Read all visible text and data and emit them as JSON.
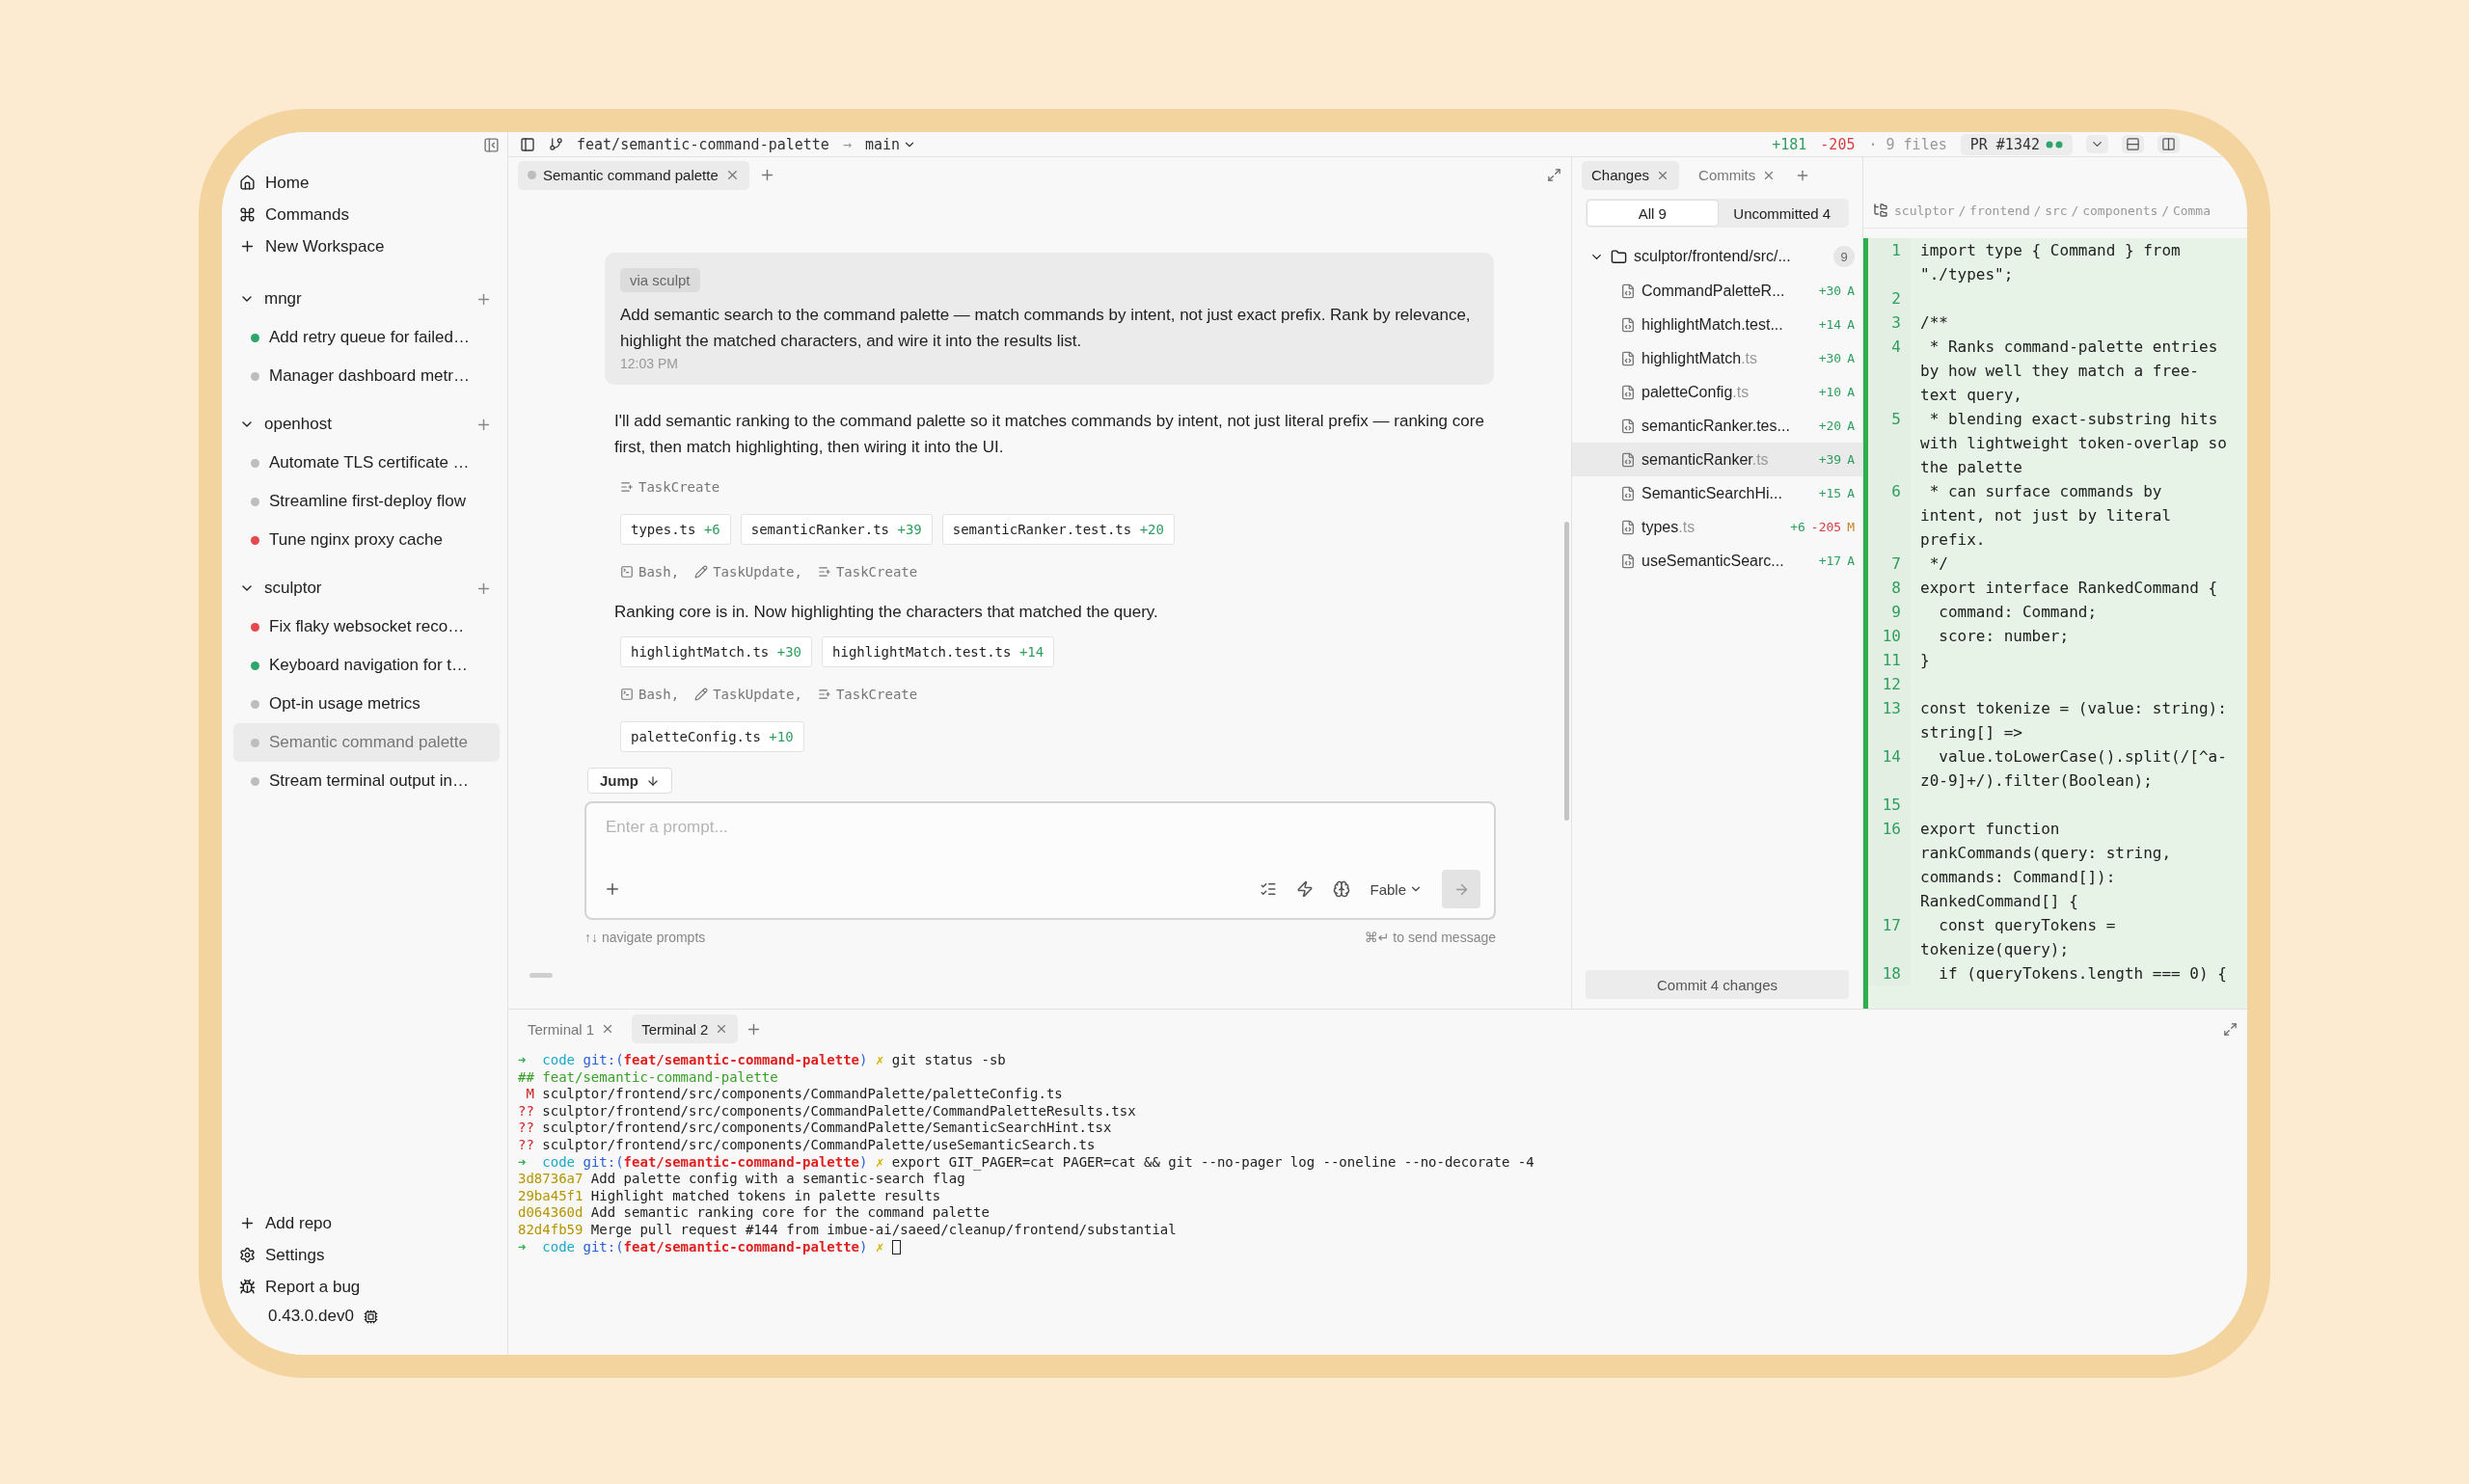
{
  "topbar": {
    "branch": "feat/semantic-command-palette",
    "arrow": "→",
    "base": "main",
    "added": "+181",
    "removed": "-205",
    "files": "· 9 files",
    "pr": "PR #1342"
  },
  "sidebar": {
    "nav": [
      {
        "kind": "home",
        "label": "Home"
      },
      {
        "kind": "command",
        "label": "Commands"
      },
      {
        "kind": "plus",
        "label": "New Workspace"
      }
    ],
    "repos": [
      {
        "name": "mngr",
        "expanded": true,
        "workspaces": [
          {
            "title": "Add retry queue for failed…",
            "color": "#2ea56a",
            "selected": false
          },
          {
            "title": "Manager dashboard metr…",
            "color": "#bdbdbd",
            "selected": false
          }
        ]
      },
      {
        "name": "openhost",
        "expanded": true,
        "workspaces": [
          {
            "title": "Automate TLS certificate …",
            "color": "#bdbdbd",
            "selected": false
          },
          {
            "title": "Streamline first-deploy flow",
            "color": "#bdbdbd",
            "selected": false
          },
          {
            "title": "Tune nginx proxy cache",
            "color": "#e5484d",
            "selected": false
          }
        ]
      },
      {
        "name": "sculptor",
        "expanded": true,
        "workspaces": [
          {
            "title": "Fix flaky websocket reco…",
            "color": "#e5484d",
            "selected": false
          },
          {
            "title": "Keyboard navigation for t…",
            "color": "#2ea56a",
            "selected": false
          },
          {
            "title": "Opt-in usage metrics",
            "color": "#bdbdbd",
            "selected": false
          },
          {
            "title": "Semantic command palette",
            "color": "#bdbdbd",
            "selected": true
          },
          {
            "title": "Stream terminal output in…",
            "color": "#bdbdbd",
            "selected": false
          }
        ]
      }
    ],
    "footer": [
      {
        "kind": "plus",
        "label": "Add repo"
      },
      {
        "kind": "settings",
        "label": "Settings"
      },
      {
        "kind": "bug",
        "label": "Report a bug"
      }
    ],
    "version": "0.43.0.dev0"
  },
  "chat": {
    "tabs": [
      {
        "label": "Semantic command palette",
        "selected": true
      }
    ],
    "items": [
      {
        "kind": "user",
        "tag": "via sculpt",
        "text": "Add semantic search to the command palette — match commands by intent, not just exact prefix. Rank by relevance, highlight the matched characters, and wire it into the results list.",
        "time": "12:03 PM"
      },
      {
        "kind": "text",
        "text": "I'll add semantic ranking to the command palette so it matches commands by intent, not just literal prefix — ranking core first, then match highlighting, then wiring it into the UI."
      },
      {
        "kind": "tools",
        "tools": [
          {
            "kind": "task",
            "label": "TaskCreate"
          }
        ]
      },
      {
        "kind": "files",
        "files": [
          {
            "name": "types.ts",
            "added": "+6"
          },
          {
            "name": "semanticRanker.ts",
            "added": "+39"
          },
          {
            "name": "semanticRanker.test.ts",
            "added": "+20"
          }
        ]
      },
      {
        "kind": "tools",
        "tools": [
          {
            "kind": "bash",
            "label": "Bash,"
          },
          {
            "kind": "edit",
            "label": "TaskUpdate,"
          },
          {
            "kind": "task",
            "label": "TaskCreate"
          }
        ]
      },
      {
        "kind": "text",
        "text": "Ranking core is in. Now highlighting the characters that matched the query."
      },
      {
        "kind": "files",
        "files": [
          {
            "name": "highlightMatch.ts",
            "added": "+30"
          },
          {
            "name": "highlightMatch.test.ts",
            "added": "+14"
          }
        ]
      },
      {
        "kind": "tools",
        "tools": [
          {
            "kind": "bash",
            "label": "Bash,"
          },
          {
            "kind": "edit",
            "label": "TaskUpdate,"
          },
          {
            "kind": "task",
            "label": "TaskCreate"
          }
        ]
      },
      {
        "kind": "files",
        "files": [
          {
            "name": "paletteConfig.ts",
            "added": "+10"
          }
        ]
      }
    ],
    "jump": "Jump",
    "composer": {
      "placeholder": "Enter a prompt...",
      "model": "Fable",
      "send_disabled": true
    },
    "hint_left": "↑↓ navigate prompts",
    "hint_right": "⌘↵ to send message"
  },
  "changes": {
    "tabs": [
      {
        "label": "Changes",
        "selected": true
      },
      {
        "label": "Commits",
        "selected": false
      }
    ],
    "filters": [
      {
        "label": "All 9",
        "selected": true
      },
      {
        "label": "Uncommitted 4",
        "selected": false
      }
    ],
    "folder": {
      "name": "sculptor/frontend/src/...",
      "count": "9",
      "expanded": true,
      "files": [
        {
          "name": "CommandPaletteR...",
          "added": "+30",
          "status": "A",
          "kind": "added",
          "selected": false
        },
        {
          "name": "highlightMatch.test...",
          "added": "+14",
          "status": "A",
          "kind": "added",
          "selected": false
        },
        {
          "name": "highlightMatch",
          "ext": ".ts",
          "added": "+30",
          "status": "A",
          "kind": "added",
          "selected": false
        },
        {
          "name": "paletteConfig",
          "ext": ".ts",
          "added": "+10",
          "status": "A",
          "kind": "added",
          "selected": false
        },
        {
          "name": "semanticRanker.tes...",
          "added": "+20",
          "status": "A",
          "kind": "added",
          "selected": false
        },
        {
          "name": "semanticRanker",
          "ext": ".ts",
          "added": "+39",
          "status": "A",
          "kind": "added",
          "selected": true
        },
        {
          "name": "SemanticSearchHi...",
          "added": "+15",
          "status": "A",
          "kind": "added",
          "selected": false
        },
        {
          "name": "types",
          "ext": ".ts",
          "added": "+6",
          "removed": "-205",
          "status": "M",
          "kind": "modified",
          "selected": false
        },
        {
          "name": "useSemanticSearc...",
          "added": "+17",
          "status": "A",
          "kind": "added",
          "selected": false
        }
      ]
    },
    "commit": "Commit 4 changes"
  },
  "code": {
    "path": "sculptor / frontend / src / components / Comma",
    "lines": [
      {
        "n": "1",
        "text": "import type { Command } from \"./types\";"
      },
      {
        "n": "2"
      },
      {
        "n": "3",
        "text": "/**"
      },
      {
        "n": "4",
        "text": " * Ranks command-palette entries by how well they match a free-text query,"
      },
      {
        "n": "5",
        "text": " * blending exact-substring hits with lightweight token-overlap so the palette"
      },
      {
        "n": "6",
        "text": " * can surface commands by intent, not just by literal prefix."
      },
      {
        "n": "7",
        "text": " */"
      },
      {
        "n": "8",
        "text": "export interface RankedCommand {"
      },
      {
        "n": "9",
        "text": "  command: Command;"
      },
      {
        "n": "10",
        "text": "  score: number;"
      },
      {
        "n": "11",
        "text": "}"
      },
      {
        "n": "12"
      },
      {
        "n": "13",
        "text": "const tokenize = (value: string): string[] =>"
      },
      {
        "n": "14",
        "text": "  value.toLowerCase().split(/[^a-z0-9]+/).filter(Boolean);"
      },
      {
        "n": "15"
      },
      {
        "n": "16",
        "text": "export function rankCommands(query: string, commands: Command[]): RankedCommand[] {"
      },
      {
        "n": "17",
        "text": "  const queryTokens = tokenize(query);"
      },
      {
        "n": "18",
        "text": "  if (queryTokens.length === 0) {"
      }
    ]
  },
  "terminal": {
    "tabs": [
      {
        "label": "Terminal 1",
        "selected": false
      },
      {
        "label": "Terminal 2",
        "selected": true
      }
    ],
    "cursor": true,
    "lines": [
      [
        {
          "kind": "arrow",
          "t": "➜  "
        },
        {
          "kind": "dir",
          "t": "code "
        },
        {
          "kind": "git",
          "t": "git:("
        },
        {
          "kind": "branch",
          "t": "feat/semantic-command-palette"
        },
        {
          "kind": "git",
          "t": ") "
        },
        {
          "kind": "dirty",
          "t": "✗ "
        },
        {
          "kind": "plain",
          "t": "git status -sb"
        }
      ],
      [
        {
          "kind": "ok",
          "t": "## feat/semantic-command-palette"
        }
      ],
      [
        {
          "kind": "err",
          "t": " M "
        },
        {
          "kind": "plain",
          "t": "sculptor/frontend/src/components/CommandPalette/paletteConfig.ts"
        }
      ],
      [
        {
          "kind": "err",
          "t": "?? "
        },
        {
          "kind": "plain",
          "t": "sculptor/frontend/src/components/CommandPalette/CommandPaletteResults.tsx"
        }
      ],
      [
        {
          "kind": "err",
          "t": "?? "
        },
        {
          "kind": "plain",
          "t": "sculptor/frontend/src/components/CommandPalette/SemanticSearchHint.tsx"
        }
      ],
      [
        {
          "kind": "err",
          "t": "?? "
        },
        {
          "kind": "plain",
          "t": "sculptor/frontend/src/components/CommandPalette/useSemanticSearch.ts"
        }
      ],
      [
        {
          "kind": "arrow",
          "t": "➜  "
        },
        {
          "kind": "dir",
          "t": "code "
        },
        {
          "kind": "git",
          "t": "git:("
        },
        {
          "kind": "branch",
          "t": "feat/semantic-command-palette"
        },
        {
          "kind": "git",
          "t": ") "
        },
        {
          "kind": "dirty",
          "t": "✗ "
        },
        {
          "kind": "plain",
          "t": "export GIT_PAGER=cat PAGER=cat && git --no-pager log --oneline --no-decorate -4"
        }
      ],
      [
        {
          "kind": "hash",
          "t": "3d8736a7 "
        },
        {
          "kind": "plain",
          "t": "Add palette config with a semantic-search flag"
        }
      ],
      [
        {
          "kind": "hash",
          "t": "29ba45f1 "
        },
        {
          "kind": "plain",
          "t": "Highlight matched tokens in palette results"
        }
      ],
      [
        {
          "kind": "hash",
          "t": "d064360d "
        },
        {
          "kind": "plain",
          "t": "Add semantic ranking core for the command palette"
        }
      ],
      [
        {
          "kind": "hash",
          "t": "82d4fb59 "
        },
        {
          "kind": "plain",
          "t": "Merge pull request #144 from imbue-ai/saeed/cleanup/frontend/substantial"
        }
      ],
      [
        {
          "kind": "arrow",
          "t": "➜  "
        },
        {
          "kind": "dir",
          "t": "code "
        },
        {
          "kind": "git",
          "t": "git:("
        },
        {
          "kind": "branch",
          "t": "feat/semantic-command-palette"
        },
        {
          "kind": "git",
          "t": ") "
        },
        {
          "kind": "dirty",
          "t": "✗ "
        }
      ]
    ]
  }
}
